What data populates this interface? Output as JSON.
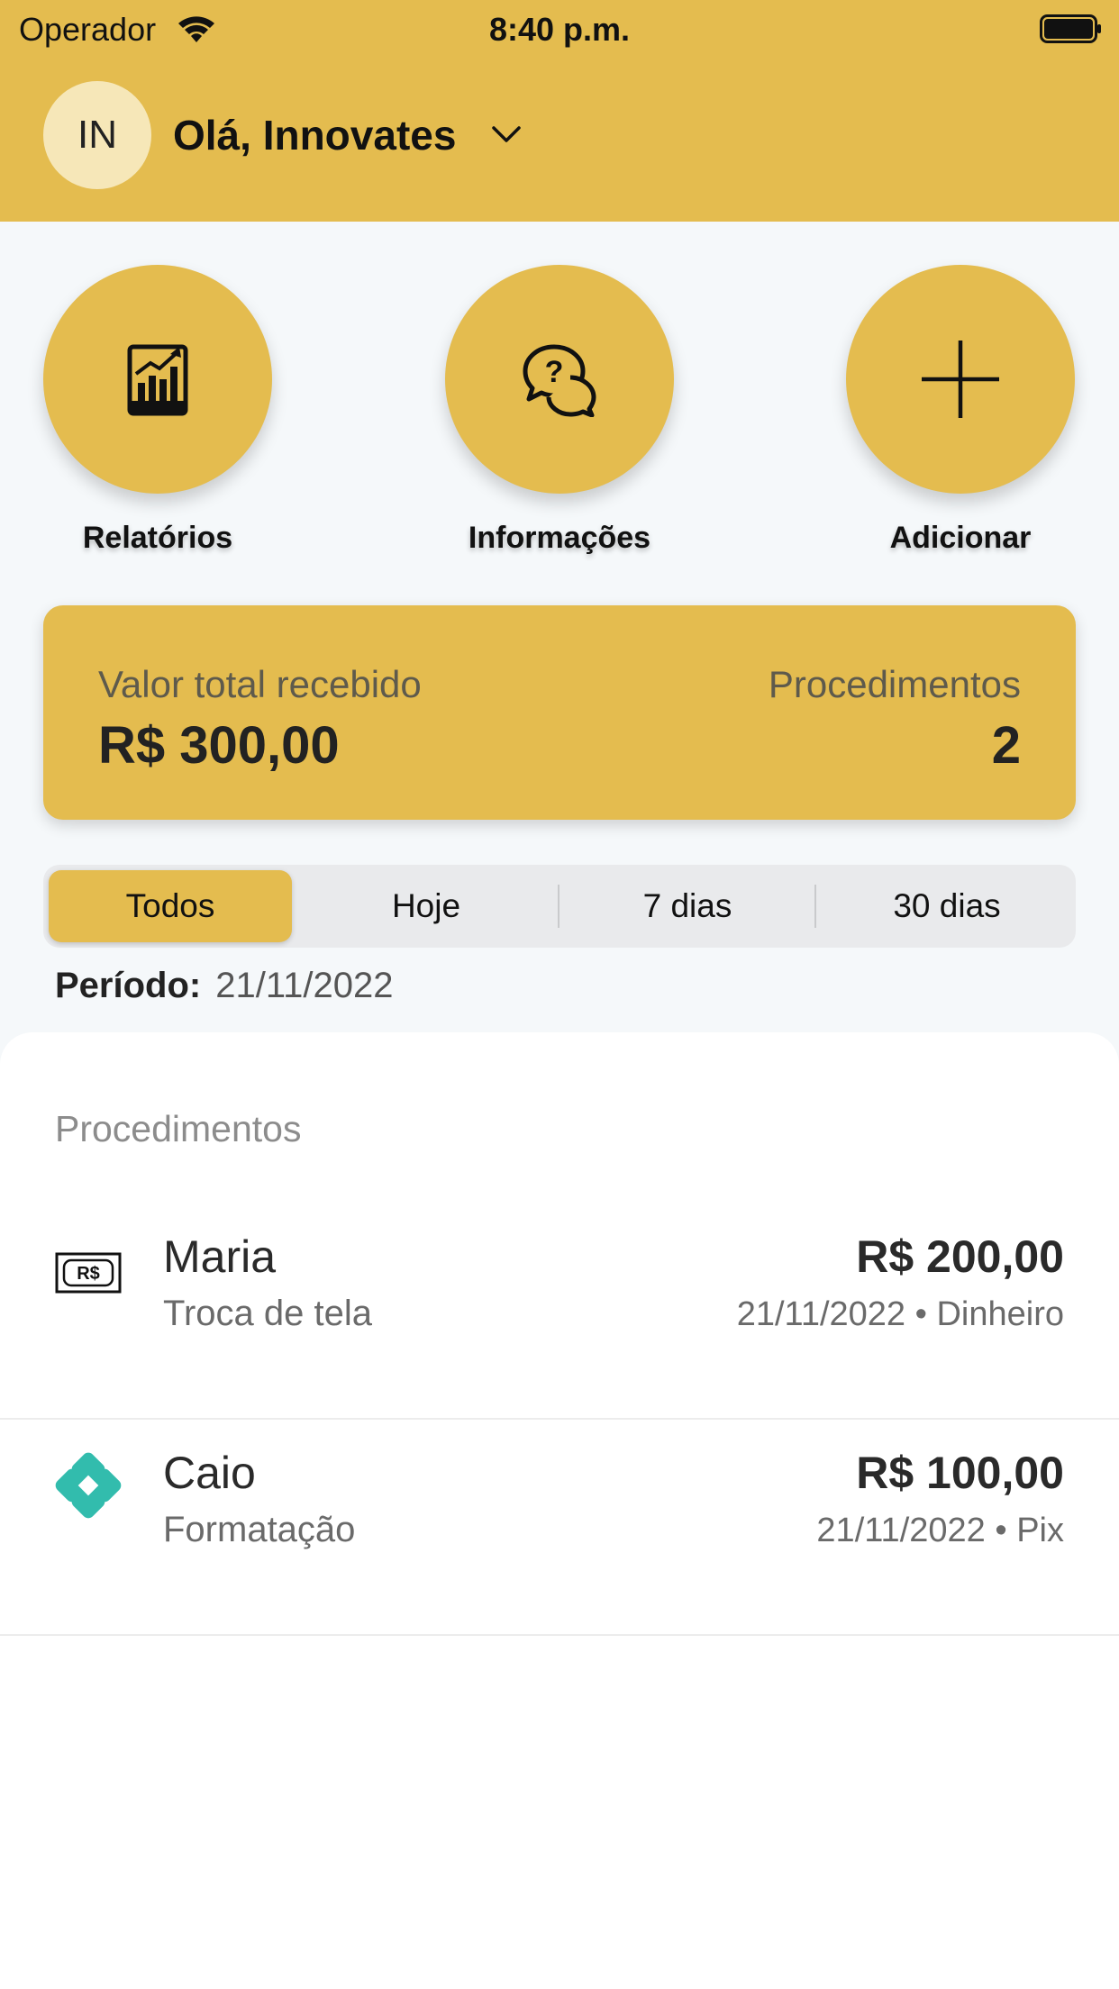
{
  "status_bar": {
    "carrier": "Operador",
    "time": "8:40 p.m."
  },
  "header": {
    "avatar_initials": "IN",
    "greeting": "Olá, Innovates"
  },
  "actions": [
    {
      "label": "Relatórios",
      "icon": "report-chart-icon"
    },
    {
      "label": "Informações",
      "icon": "help-chat-icon"
    },
    {
      "label": "Adicionar",
      "icon": "plus-icon"
    }
  ],
  "summary": {
    "total_label": "Valor total recebido",
    "total_value": "R$ 300,00",
    "count_label": "Procedimentos",
    "count_value": "2"
  },
  "filter": {
    "options": [
      "Todos",
      "Hoje",
      "7 dias",
      "30 dias"
    ],
    "selected": "Todos"
  },
  "period": {
    "label": "Período:",
    "value": "21/11/2022"
  },
  "procedures": {
    "title": "Procedimentos",
    "items": [
      {
        "name": "Maria",
        "service": "Troca de tela",
        "amount": "R$ 200,00",
        "meta": "21/11/2022 • Dinheiro",
        "icon": "cash-icon"
      },
      {
        "name": "Caio",
        "service": "Formatação",
        "amount": "R$ 100,00",
        "meta": "21/11/2022 • Pix",
        "icon": "pix-icon"
      }
    ]
  },
  "colors": {
    "accent": "#E4BC4F",
    "background": "#F5F8FA",
    "pix": "#32BCAD"
  }
}
